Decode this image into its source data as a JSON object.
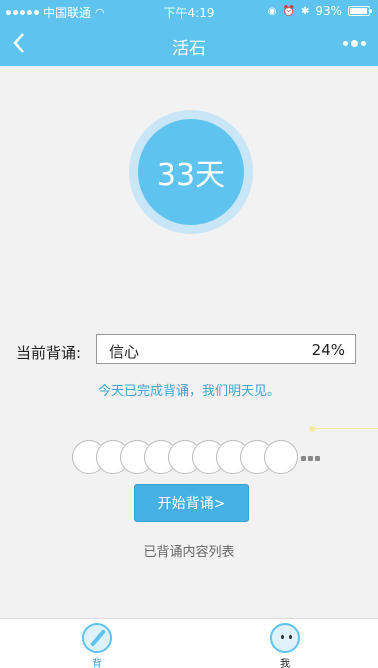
{
  "statusbar": {
    "carrier": "中国联通",
    "time": "下午4:19",
    "battery": "93%",
    "battery_level": 0.93
  },
  "navbar": {
    "title": "活石"
  },
  "counter": {
    "days": "33天"
  },
  "current": {
    "label": "当前背诵:",
    "word": "信心",
    "percent": "24%"
  },
  "message": "今天已完成背诵，我们明天见。",
  "progress_circles": 9,
  "start_button": "开始背诵>",
  "recited_list_link": "已背诵内容列表",
  "tabs": [
    {
      "label": "背",
      "icon": "compass-icon",
      "active": true
    },
    {
      "label": "我",
      "icon": "face-icon",
      "active": false
    }
  ],
  "colors": {
    "accent": "#5ec4ef",
    "button": "#44b0e3",
    "link": "#3aa6d4"
  }
}
